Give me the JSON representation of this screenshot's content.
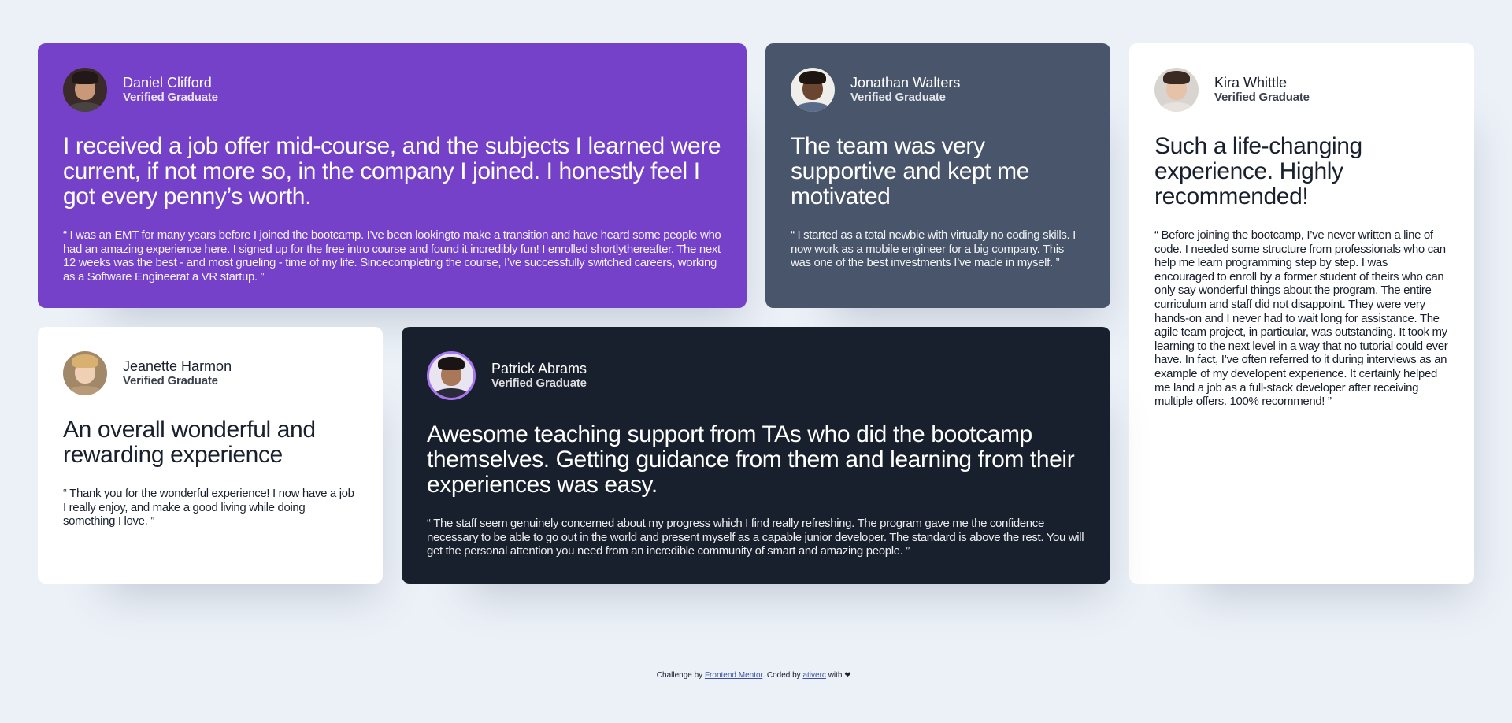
{
  "testimonials": [
    {
      "name": "Daniel Clifford",
      "role": "Verified Graduate",
      "avatar_icon": "avatar-daniel",
      "quote": "I received a job offer mid-course, and the subjects I learned were current, if not more so, in the company I joined. I honestly feel I got every penny’s worth.",
      "body": "“ I was an EMT for many years before I joined the bootcamp. I’ve been lookingto make a transition and have heard some people who had an amazing experience here. I signed up for the free intro course and found it incredibly fun! I enrolled shortlythereafter. The next 12 weeks was the best - and most grueling - time of my life. Sincecompleting the course, I’ve successfully switched careers, working as a Software Engineerat a VR startup. ”",
      "background": "#7541c8"
    },
    {
      "name": "Jonathan Walters",
      "role": "Verified Graduate",
      "avatar_icon": "avatar-jonathan",
      "quote": "The team was very supportive and kept me motivated",
      "body": "“ I started as a total newbie with virtually no coding skills. I now work as a mobile engineer for a big company. This was one of the best investments I’ve made in myself. ”",
      "background": "#48556a"
    },
    {
      "name": "Kira Whittle",
      "role": "Verified Graduate",
      "avatar_icon": "avatar-kira",
      "quote": "Such a life-changing experience. Highly recommended!",
      "body": "“ Before joining the bootcamp, I’ve never written a line of code. I needed some structure from professionals who can help me learn programming step by step. I was encouraged to enroll by a former student of theirs who can only say wonderful things about the program. The entire curriculum and staff did not disappoint. They were very hands-on and I never had to wait long for assistance. The agile team project, in particular, was outstanding. It took my learning to the next level in a way that no tutorial could ever have. In fact, I’ve often referred to it during interviews as an example of my developent experience. It certainly helped me land a job as a full-stack developer after receiving multiple offers. 100% recommend! ”",
      "background": "#ffffff"
    },
    {
      "name": "Jeanette Harmon",
      "role": "Verified Graduate",
      "avatar_icon": "avatar-jeanette",
      "quote": "An overall wonderful and rewarding experience",
      "body": "“ Thank you for the wonderful experience! I now have a job I really enjoy, and make a good living while doing something I love. ”",
      "background": "#ffffff"
    },
    {
      "name": "Patrick Abrams",
      "role": "Verified Graduate",
      "avatar_icon": "avatar-patrick",
      "quote": "Awesome teaching support from TAs who did the bootcamp themselves. Getting guidance from them and learning from their experiences was easy.",
      "body": "“ The staff seem genuinely concerned about my progress which I find really refreshing. The program gave me the confidence necessary to be able to go out in the world and present myself as a capable junior developer. The standard is above the rest. You will get the personal attention you need from an incredible community of smart and amazing people. ”",
      "background": "#19202d"
    }
  ],
  "footer": {
    "prefix": "Challenge by ",
    "link1": "Frontend Mentor",
    "middle": ". Coded by ",
    "link2": "ativerc",
    "suffix_before_heart": " with ",
    "heart_icon": "heart-icon",
    "heart": "❤",
    "end": " ."
  },
  "colors": {
    "page_bg": "#ecf1f8",
    "purple": "#7541c8",
    "grayish_blue": "#48556a",
    "dark_blue": "#19202d",
    "white": "#ffffff",
    "avatar_ring": "#a775f1"
  }
}
